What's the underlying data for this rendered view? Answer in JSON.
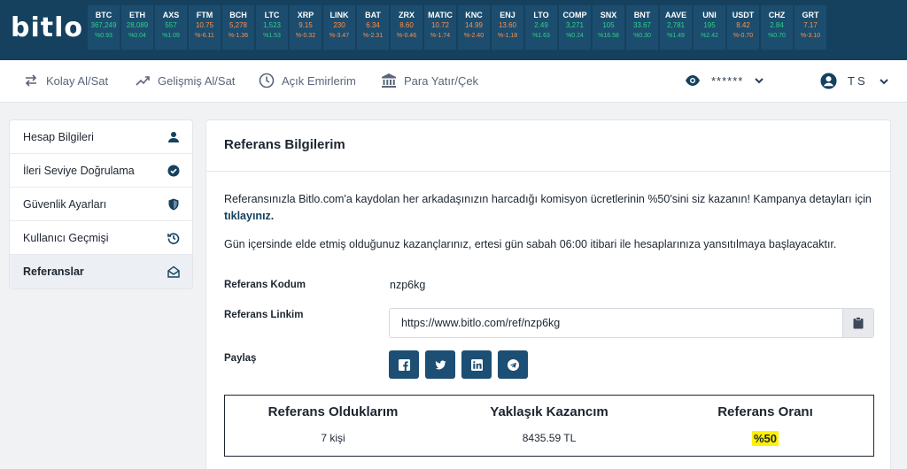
{
  "brand": {
    "logo": "bitlo"
  },
  "ticker": [
    {
      "sym": "BTC",
      "price": "367,249",
      "chg": "%0.93",
      "down": false
    },
    {
      "sym": "ETH",
      "price": "28,089",
      "chg": "%0.04",
      "down": false
    },
    {
      "sym": "AXS",
      "price": "557",
      "chg": "%1.09",
      "down": false
    },
    {
      "sym": "FTM",
      "price": "10.75",
      "chg": "%-6.11",
      "down": true
    },
    {
      "sym": "BCH",
      "price": "5,278",
      "chg": "%-1.36",
      "down": true
    },
    {
      "sym": "LTC",
      "price": "1,523",
      "chg": "%1.53",
      "down": false
    },
    {
      "sym": "XRP",
      "price": "9.15",
      "chg": "%-0.32",
      "down": true
    },
    {
      "sym": "LINK",
      "price": "230",
      "chg": "%-3.47",
      "down": true
    },
    {
      "sym": "BAT",
      "price": "6.34",
      "chg": "%-2.31",
      "down": true
    },
    {
      "sym": "ZRX",
      "price": "8.60",
      "chg": "%-0.46",
      "down": true
    },
    {
      "sym": "MATIC",
      "price": "10.72",
      "chg": "%-1.74",
      "down": true
    },
    {
      "sym": "KNC",
      "price": "14.99",
      "chg": "%-2.40",
      "down": true
    },
    {
      "sym": "ENJ",
      "price": "13.60",
      "chg": "%-1.18",
      "down": true
    },
    {
      "sym": "LTO",
      "price": "2.49",
      "chg": "%1.63",
      "down": false
    },
    {
      "sym": "COMP",
      "price": "3,271",
      "chg": "%0.24",
      "down": false
    },
    {
      "sym": "SNX",
      "price": "105",
      "chg": "%16.58",
      "down": false
    },
    {
      "sym": "BNT",
      "price": "33.67",
      "chg": "%0.30",
      "down": false
    },
    {
      "sym": "AAVE",
      "price": "2,781",
      "chg": "%1.49",
      "down": false
    },
    {
      "sym": "UNI",
      "price": "195",
      "chg": "%2.42",
      "down": false
    },
    {
      "sym": "USDT",
      "price": "8.42",
      "chg": "%-0.70",
      "down": true
    },
    {
      "sym": "CHZ",
      "price": "2.84",
      "chg": "%0.70",
      "down": false
    },
    {
      "sym": "GRT",
      "price": "7.17",
      "chg": "%-3.10",
      "down": true
    }
  ],
  "nav": {
    "easy_trade": "Kolay Al/Sat",
    "advanced_trade": "Gelişmiş Al/Sat",
    "open_orders": "Açık Emirlerim",
    "deposit_withdraw": "Para Yatır/Çek",
    "balance_masked": "******",
    "user_initials": "TS"
  },
  "sidebar": {
    "items": [
      {
        "label": "Hesap Bilgileri",
        "icon": "user-icon"
      },
      {
        "label": "İleri Seviye Doğrulama",
        "icon": "check-circle-icon"
      },
      {
        "label": "Güvenlik Ayarları",
        "icon": "shield-icon"
      },
      {
        "label": "Kullanıcı Geçmişi",
        "icon": "history-icon"
      },
      {
        "label": "Referanslar",
        "icon": "envelope-open-icon"
      }
    ]
  },
  "main": {
    "title": "Referans Bilgilerim",
    "intro_text": "Referansınızla Bitlo.com'a kaydolan her arkadaşınızın harcadığı komisyon ücretlerinin %50'sini siz kazanın! Kampanya detayları için ",
    "intro_link": "tıklayınız.",
    "info_text": "Gün içersinde elde etmiş olduğunuz kazançlarınız, ertesi gün sabah 06:00 itibari ile hesaplarınıza yansıtılmaya başlayacaktır.",
    "code_label": "Referans Kodum",
    "code_value": "nzp6kg",
    "link_label": "Referans Linkim",
    "link_value": "https://www.bitlo.com/ref/nzp6kg",
    "share_label": "Paylaş",
    "share_icons": [
      "facebook-icon",
      "twitter-icon",
      "linkedin-icon",
      "telegram-icon"
    ],
    "table": {
      "col1_header": "Referans Olduklarım",
      "col1_value": "7 kişi",
      "col2_header": "Yaklaşık Kazancım",
      "col2_value": "8435.59 TL",
      "col3_header": "Referans Oranı",
      "col3_value": "%50"
    }
  },
  "colors": {
    "topbar": "#15415f",
    "ticker_up": "#2fd088",
    "ticker_down": "#ff8f4a",
    "share_button": "#1d4e73",
    "highlight": "#fff100"
  }
}
